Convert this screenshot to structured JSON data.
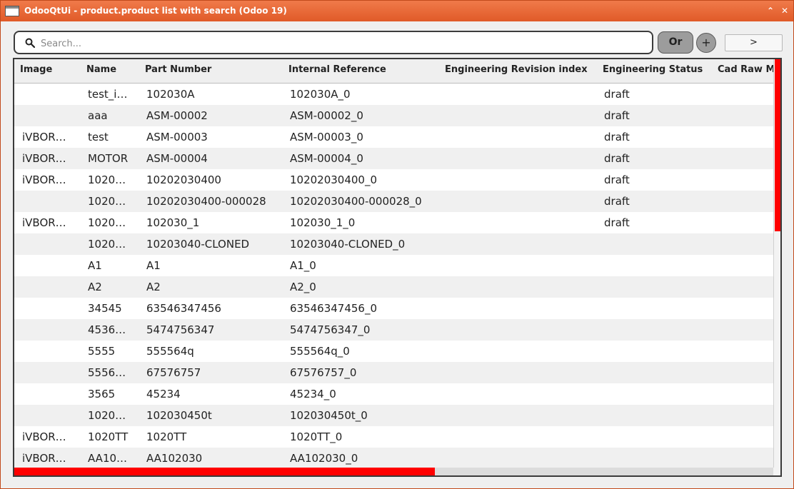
{
  "window": {
    "title": "OdooQtUi - product.product list with search (Odoo 19)",
    "maximize_glyph": "⌃",
    "close_glyph": "✕"
  },
  "search": {
    "placeholder": "Search...",
    "value": "",
    "icon": "search-icon"
  },
  "toolbar": {
    "or_label": "Or",
    "add_label": "+",
    "next_label": ">"
  },
  "colors": {
    "titlebar": "#e8663a",
    "scrollbar_thumb": "#ff0000",
    "row_alt": "#f0f0f0"
  },
  "table": {
    "columns": [
      "Image",
      "Name",
      "Part Number",
      "Internal Reference",
      "Engineering Revision index",
      "Engineering Status",
      "Cad Raw M"
    ],
    "rows": [
      [
        "",
        "test_i…",
        "102030A",
        "102030A_0",
        "",
        "draft",
        ""
      ],
      [
        "",
        "aaa",
        "ASM-00002",
        "ASM-00002_0",
        "",
        "draft",
        ""
      ],
      [
        "iVBOR…",
        "test",
        "ASM-00003",
        "ASM-00003_0",
        "",
        "draft",
        ""
      ],
      [
        "iVBOR…",
        "MOTOR",
        "ASM-00004",
        "ASM-00004_0",
        "",
        "draft",
        ""
      ],
      [
        "iVBOR…",
        "1020…",
        "10202030400",
        "10202030400_0",
        "",
        "draft",
        ""
      ],
      [
        "",
        "1020…",
        "10202030400-000028",
        "10202030400-000028_0",
        "",
        "draft",
        ""
      ],
      [
        "iVBOR…",
        "1020…",
        "102030_1",
        "102030_1_0",
        "",
        "draft",
        ""
      ],
      [
        "",
        "1020…",
        "10203040-CLONED",
        "10203040-CLONED_0",
        "",
        "",
        ""
      ],
      [
        "",
        "A1",
        "A1",
        "A1_0",
        "",
        "",
        ""
      ],
      [
        "",
        "A2",
        "A2",
        "A2_0",
        "",
        "",
        ""
      ],
      [
        "",
        "34545",
        "63546347456",
        "63546347456_0",
        "",
        "",
        ""
      ],
      [
        "",
        "4536…",
        "5474756347",
        "5474756347_0",
        "",
        "",
        ""
      ],
      [
        "",
        "5555",
        "555564q",
        "555564q_0",
        "",
        "",
        ""
      ],
      [
        "",
        "5556…",
        "67576757",
        "67576757_0",
        "",
        "",
        ""
      ],
      [
        "",
        "3565",
        "45234",
        "45234_0",
        "",
        "",
        ""
      ],
      [
        "",
        "1020…",
        "102030450t",
        "102030450t_0",
        "",
        "",
        ""
      ],
      [
        "iVBOR…",
        "1020TT",
        "1020TT",
        "1020TT_0",
        "",
        "",
        ""
      ],
      [
        "iVBOR…",
        "AA10…",
        "AA102030",
        "AA102030_0",
        "",
        "",
        ""
      ]
    ]
  }
}
